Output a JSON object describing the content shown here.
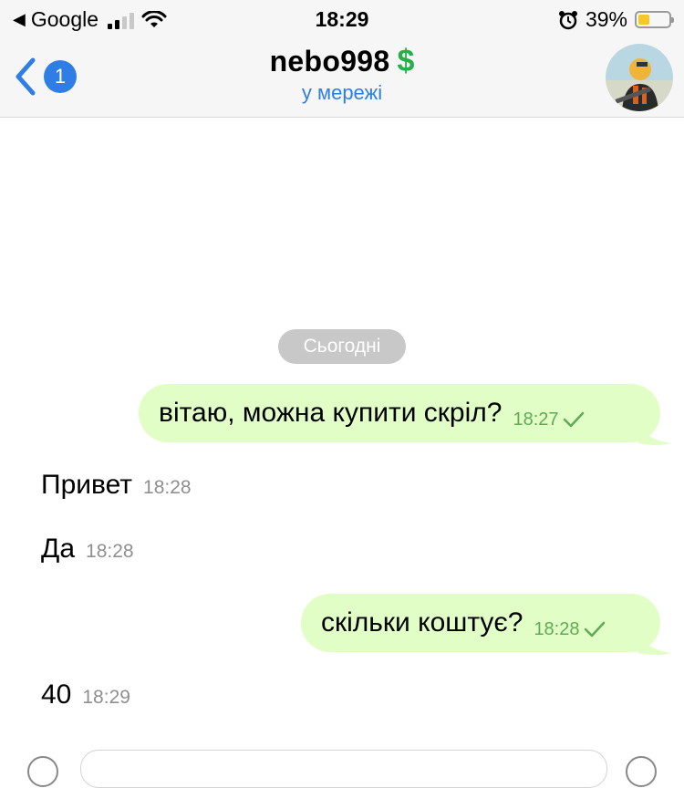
{
  "status_bar": {
    "carrier": "Google",
    "time": "18:29",
    "battery_percent": "39%",
    "battery_level": 0.39,
    "colors": {
      "battery_fill": "#f5c829"
    }
  },
  "header": {
    "back_badge": "1",
    "title": "nebo998",
    "title_emoji": "$",
    "subtitle": "у мережі",
    "colors": {
      "accent": "#2f7ee6",
      "dollar": "#25b04a"
    }
  },
  "chat": {
    "date_separator": "Сьогодні",
    "messages": [
      {
        "direction": "out",
        "text": "вітаю, можна купити скріл?",
        "time": "18:27",
        "read_icon": "check-icon"
      },
      {
        "direction": "in",
        "text": "Привет",
        "time": "18:28"
      },
      {
        "direction": "in",
        "text": "Да",
        "time": "18:28"
      },
      {
        "direction": "out",
        "text": "скільки коштує?",
        "time": "18:28",
        "read_icon": "check-icon"
      },
      {
        "direction": "in",
        "text": "40",
        "time": "18:29"
      }
    ],
    "colors": {
      "outgoing_bubble": "#e1fec6",
      "outgoing_time": "#5faa55",
      "incoming_time": "#8f8f8f"
    }
  }
}
